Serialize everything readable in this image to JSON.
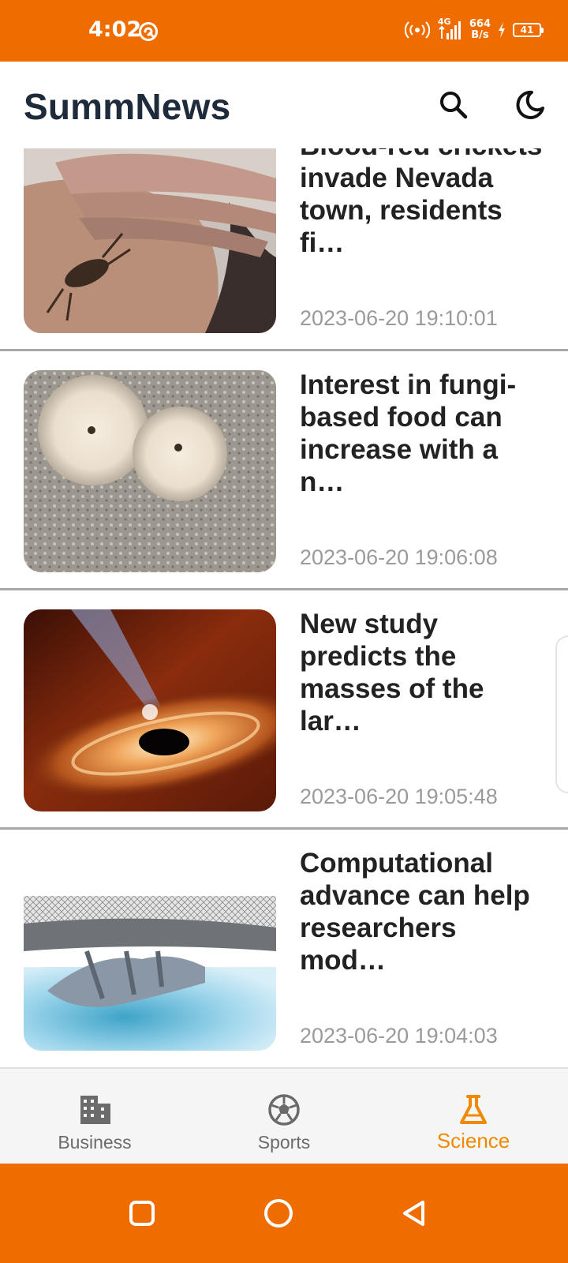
{
  "status_bar": {
    "time": "4:02",
    "network": "4G",
    "speed_value": "664",
    "speed_unit": "B/s",
    "battery": "41"
  },
  "header": {
    "title": "SummNews",
    "search_icon": "search-icon",
    "theme_icon": "moon-icon"
  },
  "articles": [
    {
      "title": "Blood-red crickets invade Nevada town, residents fi…",
      "timestamp": "2023-06-20 19:10:01"
    },
    {
      "title": "Interest in fungi-based food can increase with a n…",
      "timestamp": "2023-06-20 19:06:08"
    },
    {
      "title": "New study predicts the masses of the lar…",
      "timestamp": "2023-06-20 19:05:48"
    },
    {
      "title": "Computational advance can help researchers mod…",
      "timestamp": "2023-06-20 19:04:03"
    }
  ],
  "bottom_nav": {
    "active": "Science",
    "items": [
      {
        "label": "Business",
        "icon": "building-icon"
      },
      {
        "label": "Sports",
        "icon": "soccer-ball-icon"
      },
      {
        "label": "Science",
        "icon": "flask-icon"
      }
    ]
  },
  "colors": {
    "accent": "#ef6c00",
    "active_tab": "#ef8a00",
    "title": "#1e2b3c",
    "timestamp": "#9a9a9a"
  }
}
